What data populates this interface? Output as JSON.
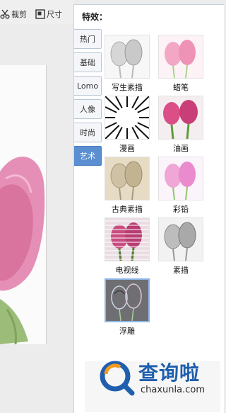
{
  "toolbar": {
    "crop_label": "裁剪",
    "size_label": "尺寸"
  },
  "panel": {
    "title": "特效："
  },
  "tabs": [
    {
      "label": "热门",
      "active": false
    },
    {
      "label": "基础",
      "active": false
    },
    {
      "label": "Lomo",
      "active": false
    },
    {
      "label": "人像",
      "active": false
    },
    {
      "label": "时尚",
      "active": false
    },
    {
      "label": "艺术",
      "active": true
    }
  ],
  "effects": [
    {
      "label": "写生素描",
      "style": "sketch"
    },
    {
      "label": "蜡笔",
      "style": "crayon"
    },
    {
      "label": "漫画",
      "style": "comic"
    },
    {
      "label": "油画",
      "style": "oil"
    },
    {
      "label": "古典素描",
      "style": "classic"
    },
    {
      "label": "彩铅",
      "style": "pencil"
    },
    {
      "label": "电视线",
      "style": "tvlines"
    },
    {
      "label": "素描",
      "style": "gray"
    },
    {
      "label": "浮雕",
      "style": "emboss",
      "selected": true
    }
  ],
  "watermark": {
    "brand": "查询啦",
    "url": "chaxunla.com"
  },
  "colors": {
    "active_tab": "#5b8fd1",
    "brand_blue": "#1f5fae",
    "brand_orange": "#f29b1f"
  }
}
